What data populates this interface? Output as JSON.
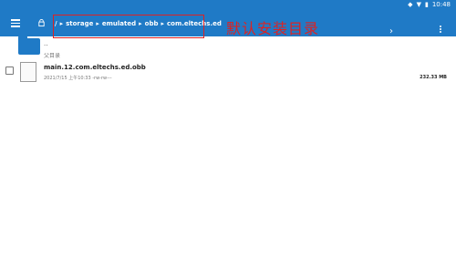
{
  "status": {
    "time": "10:48"
  },
  "appbar": {
    "path": [
      {
        "label": "/"
      },
      {
        "label": "storage"
      },
      {
        "label": "emulated"
      },
      {
        "label": "obb"
      },
      {
        "label": "com.eltechs.ed"
      }
    ]
  },
  "annotation": {
    "text": "默认安装目录"
  },
  "list": {
    "up": {
      "dots": "..",
      "label": "父目录"
    },
    "files": [
      {
        "name": "main.12.com.eltechs.ed.obb",
        "meta": "2021/7/15 上午10:33  -rw-rw---",
        "size": "232.33 MB"
      }
    ]
  }
}
